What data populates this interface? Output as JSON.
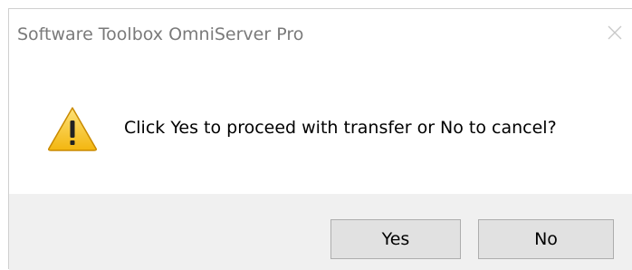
{
  "window": {
    "title": "Software Toolbox OmniServer Pro"
  },
  "dialog": {
    "icon": "warning-triangle-icon",
    "message": "Click Yes to proceed with transfer or No to cancel?"
  },
  "buttons": {
    "yes_label": "Yes",
    "no_label": "No"
  },
  "colors": {
    "warning_yellow": "#f5c518",
    "footer_bg": "#f0f0f0",
    "button_bg": "#e1e1e1"
  }
}
